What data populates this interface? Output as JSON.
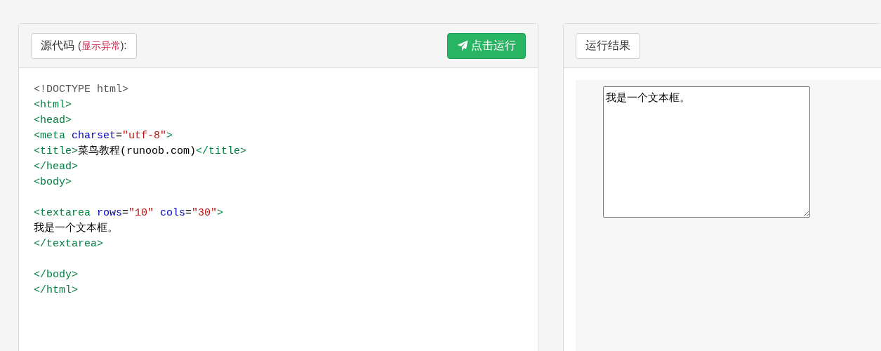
{
  "source_panel": {
    "label_parts": [
      {
        "kind": "main",
        "text": "源代码"
      },
      {
        "kind": "small",
        "text": "("
      },
      {
        "kind": "alert",
        "text": "显示异常"
      },
      {
        "kind": "small",
        "text": ")"
      },
      {
        "kind": "main",
        "text": ":"
      }
    ],
    "run_button": "点击运行",
    "code_lines": [
      {
        "kind": "code",
        "tokens": [
          {
            "kind": "doctype",
            "text": "<!DOCTYPE html>"
          }
        ]
      },
      {
        "kind": "code",
        "tokens": [
          {
            "kind": "tag",
            "text": "<html>"
          }
        ]
      },
      {
        "kind": "code",
        "tokens": [
          {
            "kind": "tag",
            "text": "<head>"
          }
        ]
      },
      {
        "kind": "code",
        "tokens": [
          {
            "kind": "tag",
            "text": "<meta "
          },
          {
            "kind": "attr",
            "text": "charset"
          },
          {
            "kind": "text",
            "text": "="
          },
          {
            "kind": "value",
            "text": "\"utf-8\""
          },
          {
            "kind": "tag",
            "text": ">"
          }
        ]
      },
      {
        "kind": "code",
        "tokens": [
          {
            "kind": "tag",
            "text": "<title>"
          },
          {
            "kind": "text",
            "text": "菜鸟教程(runoob.com)"
          },
          {
            "kind": "tag",
            "text": "</title>"
          }
        ]
      },
      {
        "kind": "code",
        "tokens": [
          {
            "kind": "tag",
            "text": "</head>"
          }
        ]
      },
      {
        "kind": "code",
        "tokens": [
          {
            "kind": "tag",
            "text": "<body>"
          }
        ]
      },
      {
        "kind": "blank"
      },
      {
        "kind": "code",
        "tokens": [
          {
            "kind": "tag",
            "text": "<textarea "
          },
          {
            "kind": "attr",
            "text": "rows"
          },
          {
            "kind": "text",
            "text": "="
          },
          {
            "kind": "value",
            "text": "\"10\""
          },
          {
            "kind": "attr",
            "text": " cols"
          },
          {
            "kind": "text",
            "text": "="
          },
          {
            "kind": "value",
            "text": "\"30\""
          },
          {
            "kind": "tag",
            "text": ">"
          }
        ]
      },
      {
        "kind": "code",
        "tokens": [
          {
            "kind": "text",
            "text": "我是一个文本框。"
          }
        ]
      },
      {
        "kind": "code",
        "tokens": [
          {
            "kind": "tag",
            "text": "</textarea>"
          }
        ]
      },
      {
        "kind": "blank"
      },
      {
        "kind": "code",
        "tokens": [
          {
            "kind": "tag",
            "text": "</body>"
          }
        ]
      },
      {
        "kind": "code",
        "tokens": [
          {
            "kind": "tag",
            "text": "</html>"
          }
        ]
      }
    ]
  },
  "result_panel": {
    "label": "运行结果",
    "textarea_value": "我是一个文本框。"
  }
}
